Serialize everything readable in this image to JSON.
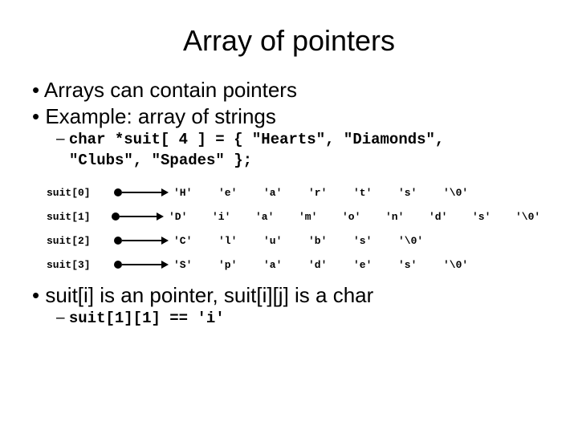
{
  "title": "Array of pointers",
  "bullets": {
    "b1": "Arrays can contain pointers",
    "b2": "Example: array of strings",
    "code_line1": "char *suit[ 4 ] = { \"Hearts\", \"Diamonds\",",
    "code_line2": "\"Clubs\", \"Spades\" };"
  },
  "rows": [
    {
      "label": "suit[0]",
      "cells": [
        "'H'",
        "'e'",
        "'a'",
        "'r'",
        "'t'",
        "'s'",
        "'\\0'"
      ]
    },
    {
      "label": "suit[1]",
      "cells": [
        "'D'",
        "'i'",
        "'a'",
        "'m'",
        "'o'",
        "'n'",
        "'d'",
        "'s'",
        "'\\0'"
      ]
    },
    {
      "label": "suit[2]",
      "cells": [
        "'C'",
        "'l'",
        "'u'",
        "'b'",
        "'s'",
        "'\\0'"
      ]
    },
    {
      "label": "suit[3]",
      "cells": [
        "'S'",
        "'p'",
        "'a'",
        "'d'",
        "'e'",
        "'s'",
        "'\\0'"
      ]
    }
  ],
  "bottom": {
    "text": "suit[i] is an pointer, suit[i][j] is a char",
    "sub": "suit[1][1] == 'i'"
  }
}
